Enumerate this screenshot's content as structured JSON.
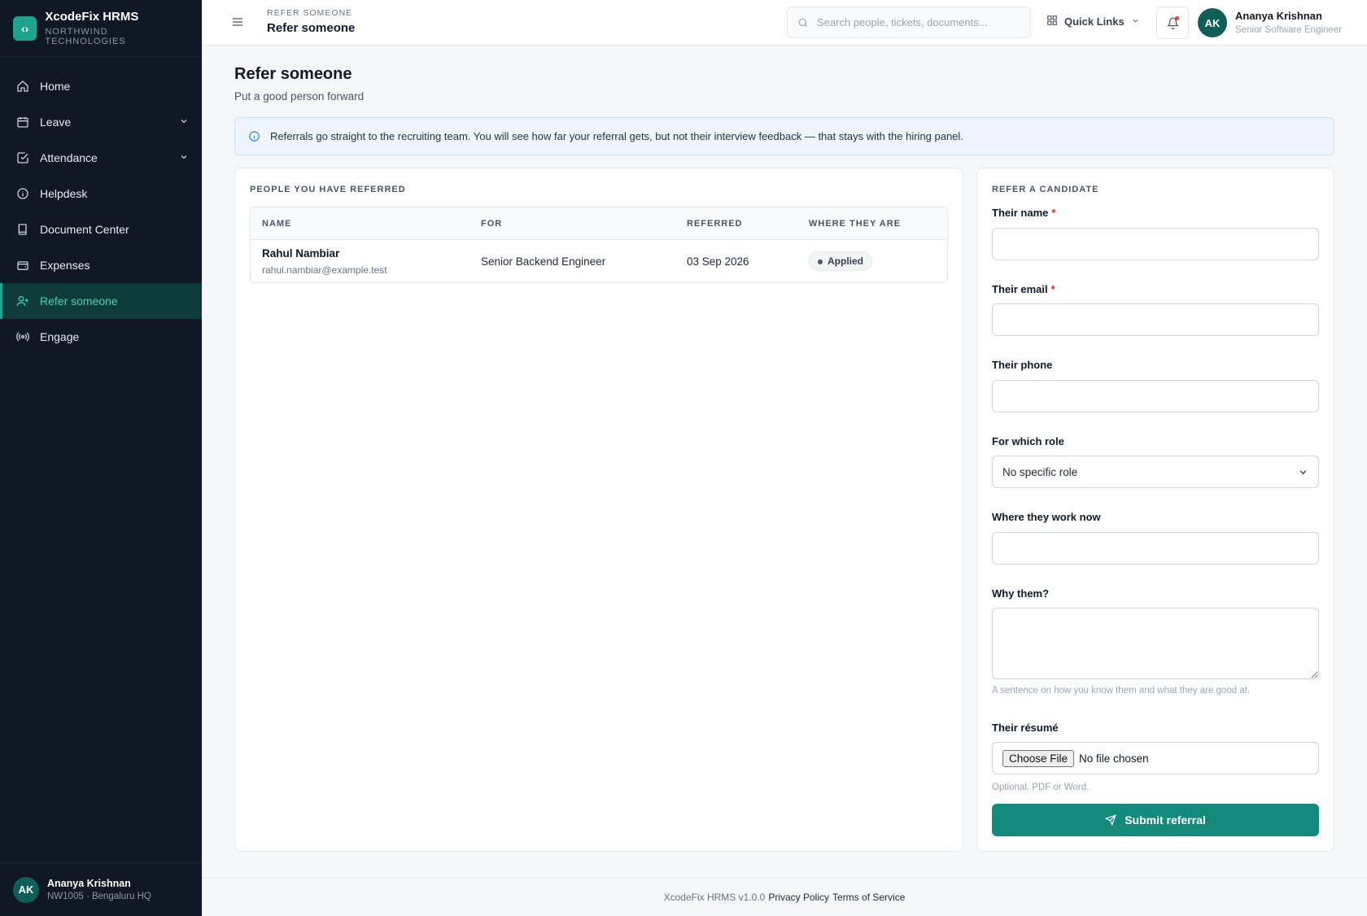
{
  "app": {
    "name": "XcodeFix HRMS",
    "org": "NORTHWIND TECHNOLOGIES",
    "logo_glyph": "‹›"
  },
  "sidebar": {
    "items": [
      {
        "label": "Home",
        "icon": "home-icon"
      },
      {
        "label": "Leave",
        "icon": "calendar-icon",
        "expandable": true
      },
      {
        "label": "Attendance",
        "icon": "check-square-icon",
        "expandable": true
      },
      {
        "label": "Helpdesk",
        "icon": "info-circle-icon"
      },
      {
        "label": "Document Center",
        "icon": "book-icon"
      },
      {
        "label": "Expenses",
        "icon": "wallet-icon"
      },
      {
        "label": "Refer someone",
        "icon": "user-plus-icon",
        "active": true
      },
      {
        "label": "Engage",
        "icon": "broadcast-icon"
      }
    ],
    "user": {
      "initials": "AK",
      "name": "Ananya Krishnan",
      "sub": "NW1005 · Bengaluru HQ"
    }
  },
  "header": {
    "crumb_small": "REFER SOMEONE",
    "crumb_title": "Refer someone",
    "search_placeholder": "Search people, tickets, documents...",
    "quick_links": "Quick Links",
    "user": {
      "initials": "AK",
      "name": "Ananya Krishnan",
      "role": "Senior Software Engineer"
    }
  },
  "page": {
    "title": "Refer someone",
    "subtitle": "Put a good person forward",
    "info": "Referrals go straight to the recruiting team. You will see how far your referral gets, but not their interview feedback — that stays with the hiring panel."
  },
  "referred": {
    "title": "PEOPLE YOU HAVE REFERRED",
    "columns": [
      "NAME",
      "FOR",
      "REFERRED",
      "WHERE THEY ARE"
    ],
    "rows": [
      {
        "name": "Rahul Nambiar",
        "email": "rahul.nambiar@example.test",
        "for": "Senior Backend Engineer",
        "referred": "03 Sep 2026",
        "status": "Applied"
      }
    ]
  },
  "form": {
    "title": "REFER A CANDIDATE",
    "name_label": "Their name",
    "email_label": "Their email",
    "phone_label": "Their phone",
    "role_label": "For which role",
    "role_value": "No specific role",
    "work_label": "Where they work now",
    "why_label": "Why them?",
    "why_hint": "A sentence on how you know them and what they are good at.",
    "resume_label": "Their résumé",
    "file_button": "Choose File",
    "file_status": "No file chosen",
    "resume_hint": "Optional. PDF or Word.",
    "required_mark": "*",
    "submit": "Submit referral"
  },
  "footer": {
    "version": "XcodeFix HRMS v1.0.0",
    "privacy": "Privacy Policy",
    "terms": "Terms of Service"
  },
  "colors": {
    "sidebar_bg": "#0f1824",
    "accent": "#1ea390",
    "submit_bg": "#138a7b",
    "info_bg": "#eef5ff"
  }
}
